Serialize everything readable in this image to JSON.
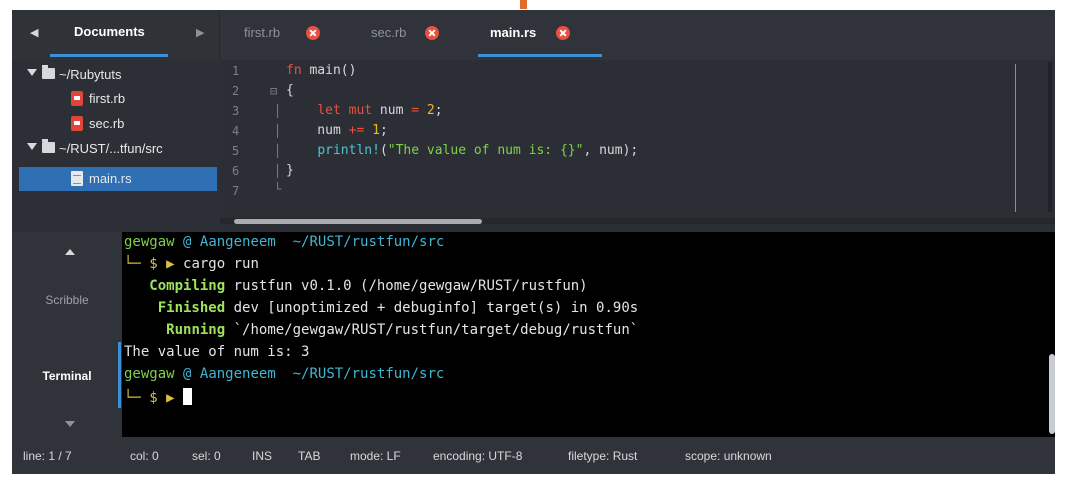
{
  "sidebar": {
    "tab_title": "Documents",
    "tree": [
      {
        "label": "~/Rubytuts",
        "kind": "folder"
      },
      {
        "label": "first.rb",
        "kind": "ruby-file"
      },
      {
        "label": "sec.rb",
        "kind": "ruby-file"
      },
      {
        "label": "~/RUST/...tfun/src",
        "kind": "folder"
      },
      {
        "label": "main.rs",
        "kind": "rust-file",
        "selected": true
      }
    ]
  },
  "tabs": [
    {
      "label": "first.rb",
      "active": false
    },
    {
      "label": "sec.rb",
      "active": false
    },
    {
      "label": "main.rs",
      "active": true
    }
  ],
  "editor": {
    "line_numbers": [
      "1",
      "2",
      "3",
      "4",
      "5",
      "6",
      "7"
    ],
    "code": [
      [
        {
          "t": "fn",
          "c": "kw"
        },
        {
          "t": " main()",
          "c": ""
        }
      ],
      [
        {
          "t": "{",
          "c": ""
        }
      ],
      [
        {
          "t": "    ",
          "c": ""
        },
        {
          "t": "let",
          "c": "kw"
        },
        {
          "t": " ",
          "c": ""
        },
        {
          "t": "mut",
          "c": "kw"
        },
        {
          "t": " num ",
          "c": ""
        },
        {
          "t": "=",
          "c": "op"
        },
        {
          "t": " ",
          "c": ""
        },
        {
          "t": "2",
          "c": "num"
        },
        {
          "t": ";",
          "c": ""
        }
      ],
      [
        {
          "t": "    num ",
          "c": ""
        },
        {
          "t": "+=",
          "c": "op"
        },
        {
          "t": " ",
          "c": ""
        },
        {
          "t": "1",
          "c": "num"
        },
        {
          "t": ";",
          "c": ""
        }
      ],
      [
        {
          "t": "    ",
          "c": ""
        },
        {
          "t": "println!",
          "c": "mac"
        },
        {
          "t": "(",
          "c": ""
        },
        {
          "t": "\"The value of num is: {}\"",
          "c": "str"
        },
        {
          "t": ", num);",
          "c": ""
        }
      ],
      [
        {
          "t": "}",
          "c": ""
        }
      ],
      [
        {
          "t": "",
          "c": ""
        }
      ]
    ]
  },
  "bottom_tabs": {
    "scribble": "Scribble",
    "terminal": "Terminal"
  },
  "terminal": {
    "prompt_user": "gewgaw",
    "prompt_at": "@",
    "prompt_host": "Aangeneem",
    "prompt_path": "~/RUST/rustfun/src",
    "prompt_symbol": "└─ $ ▶",
    "command": "cargo run",
    "compiling_label": "Compiling",
    "compiling_text": "rustfun v0.1.0 (/home/gewgaw/RUST/rustfun)",
    "finished_label": "Finished",
    "finished_text": "dev [unoptimized + debuginfo] target(s) in 0.90s",
    "running_label": "Running",
    "running_text": "`/home/gewgaw/RUST/rustfun/target/debug/rustfun`",
    "output": "The value of num is: 3"
  },
  "status": {
    "line": "line: 1 / 7",
    "col": "col: 0",
    "sel": "sel: 0",
    "ins": "INS",
    "tab": "TAB",
    "mode": "mode: LF",
    "encoding": "encoding: UTF-8",
    "filetype": "filetype: Rust",
    "scope": "scope: unknown"
  },
  "colors": {
    "accent": "#3d8fd8",
    "close_badge": "#e8503f",
    "keyword": "#e8503f",
    "number": "#f0b429",
    "string": "#7fd14a",
    "macro": "#4fc3d6"
  },
  "icons": {
    "sidebar_prev": "arrow-left-icon",
    "sidebar_next": "arrow-right-icon",
    "tab_close": "close-circle-icon",
    "folder": "folder-icon",
    "ruby_file": "ruby-file-icon",
    "rust_file": "text-file-icon"
  }
}
